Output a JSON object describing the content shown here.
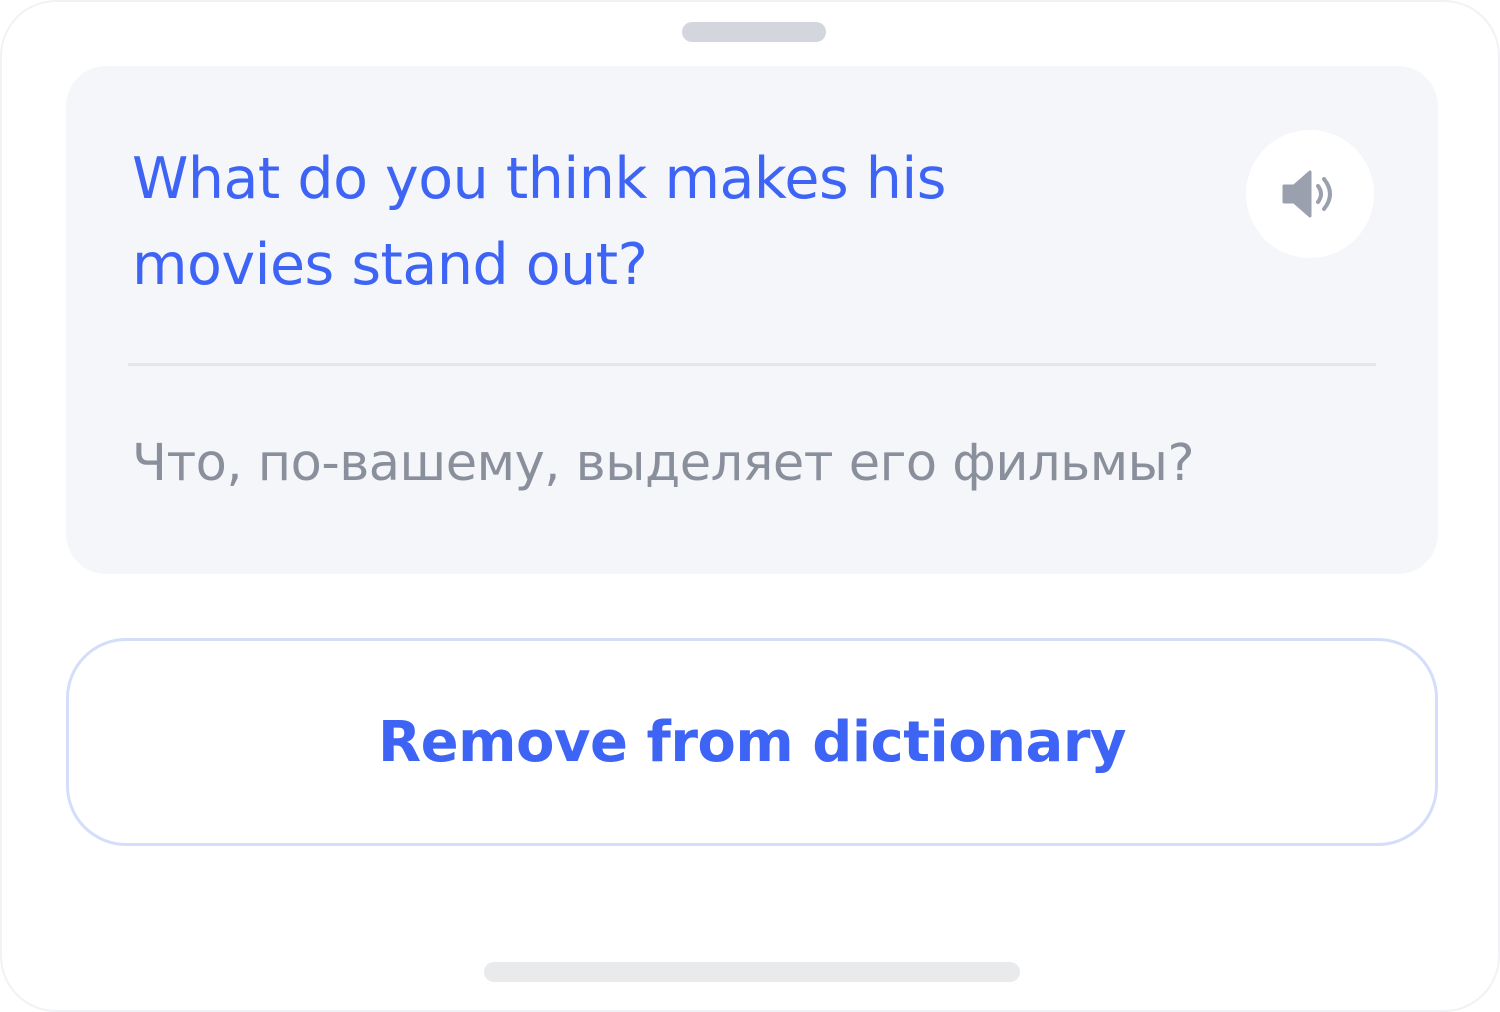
{
  "phrase": {
    "english": "What do you think makes his movies stand out?",
    "translation": "Что, по-вашему, выделяет его фильмы?"
  },
  "audio_button": {
    "icon": "speaker-icon"
  },
  "actions": {
    "remove_label": "Remove from dictionary"
  },
  "colors": {
    "accent": "#3d64f5",
    "translation_text": "#8a8f9c",
    "card_background": "#f4f6f9",
    "speaker_icon": "#9aa0ad",
    "button_border": "#d4defb"
  }
}
